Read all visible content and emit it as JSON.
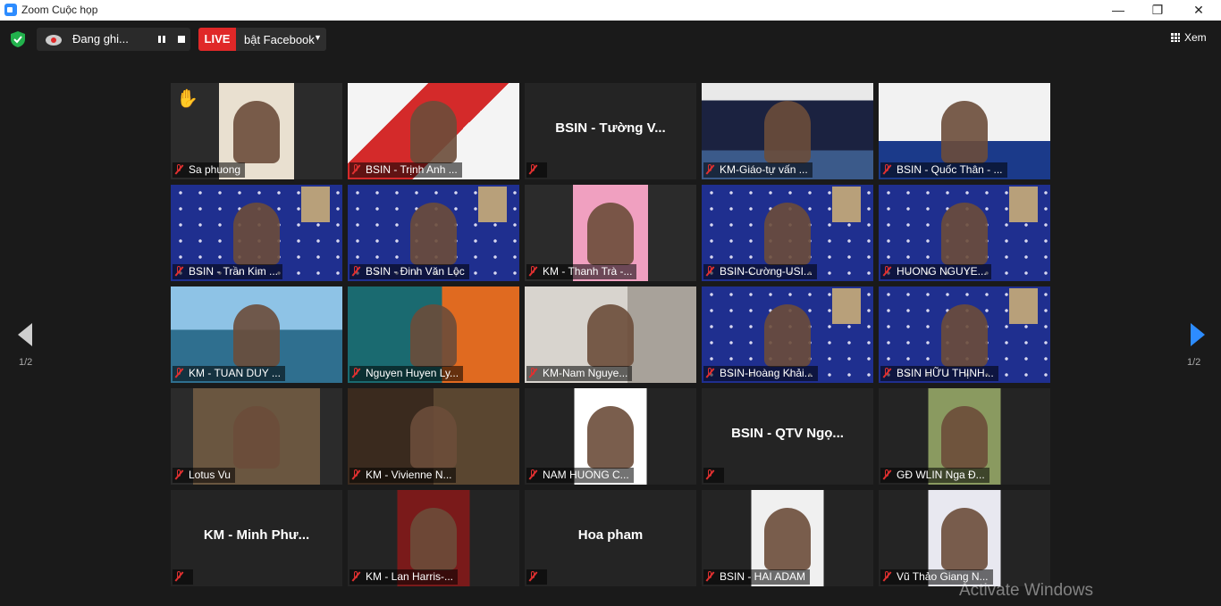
{
  "window": {
    "title": "Zoom Cuộc họp"
  },
  "toolbar": {
    "recording_label": "Đang ghi...",
    "live_badge": "LIVE",
    "live_target": "bật Facebook",
    "view_label": "Xem"
  },
  "pager": {
    "left": "1/2",
    "right": "1/2"
  },
  "watermark": "Activate Windows",
  "participants": [
    {
      "name": "Sa phuong",
      "video": true,
      "hand_raised": true
    },
    {
      "name": "BSIN - Trịnh Anh ...",
      "video": true
    },
    {
      "name": "BSIN - Tường V...",
      "video": false
    },
    {
      "name": "KM-Giáo-tự vấn ...",
      "video": true
    },
    {
      "name": "BSIN - Quốc Thân - ...",
      "video": true
    },
    {
      "name": "BSIN - Trần Kim ...",
      "video": true
    },
    {
      "name": "BSIN - Đinh Văn Lộc",
      "video": true,
      "active_speaker": true
    },
    {
      "name": "KM - Thanh Trà -...",
      "video": true
    },
    {
      "name": "BSIN-Cường-USI...",
      "video": true
    },
    {
      "name": "HUONG NGUYE...",
      "video": true
    },
    {
      "name": "KM - TUAN DUY ...",
      "video": true
    },
    {
      "name": "Nguyen Huyen Ly...",
      "video": true
    },
    {
      "name": "KM-Nam Nguye...",
      "video": true
    },
    {
      "name": "BSIN-Hoàng Khải...",
      "video": true
    },
    {
      "name": "BSIN HỮU THỊNH...",
      "video": true
    },
    {
      "name": "Lotus Vu",
      "video": true
    },
    {
      "name": "KM - Vivienne N...",
      "video": true
    },
    {
      "name": "NAM HUONG C...",
      "video": true
    },
    {
      "name": "BSIN - QTV Ngọ...",
      "video": false
    },
    {
      "name": "GĐ WLIN Nga Đ...",
      "video": true
    },
    {
      "name": "KM - Minh Phư...",
      "video": false
    },
    {
      "name": "KM - Lan Harris-...",
      "video": true
    },
    {
      "name": "Hoa pham",
      "video": false
    },
    {
      "name": "BSIN - HAI ADAM",
      "video": true
    },
    {
      "name": "Vũ Thảo Giang N...",
      "video": true
    }
  ],
  "colors": {
    "live": "#e02828",
    "active_border": "#e6e64a",
    "nav_arrow": "#2d8cff"
  }
}
